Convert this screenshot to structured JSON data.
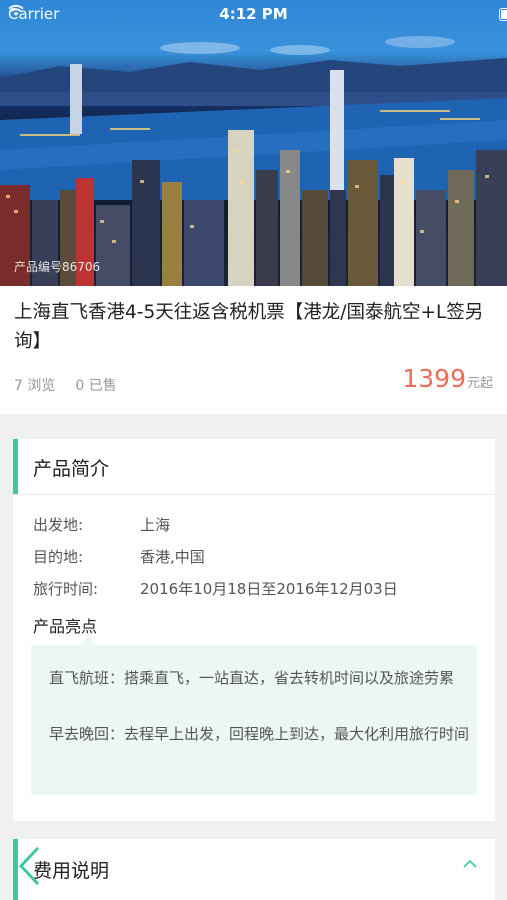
{
  "status_bar": {
    "carrier": "Carrier",
    "time": "4:12 PM"
  },
  "hero": {
    "product_code": "产品编号86706"
  },
  "product": {
    "title": "上海直飞香港4-5天往返含税机票【港龙/国泰航空+L签另询】",
    "views": "7 浏览",
    "sold": "0 已售",
    "price": "1399",
    "price_unit": "元起",
    "price_color": "#f06d55"
  },
  "intro": {
    "title": "产品简介",
    "rows": [
      {
        "label": "出发地:",
        "value": "上海"
      },
      {
        "label": "目的地:",
        "value": "香港,中国"
      },
      {
        "label": "旅行时间:",
        "value": "2016年10月18日至2016年12月03日"
      }
    ],
    "highlights_title": "产品亮点",
    "highlights": [
      "直飞航班：搭乘直飞，一站直达，省去转机时间以及旅途劳累",
      "早去晚回：去程早上出发，回程晚上到达，最大化利用旅行时间"
    ]
  },
  "fees": {
    "title": "费用说明"
  },
  "accent_color": "#3dc8a0"
}
